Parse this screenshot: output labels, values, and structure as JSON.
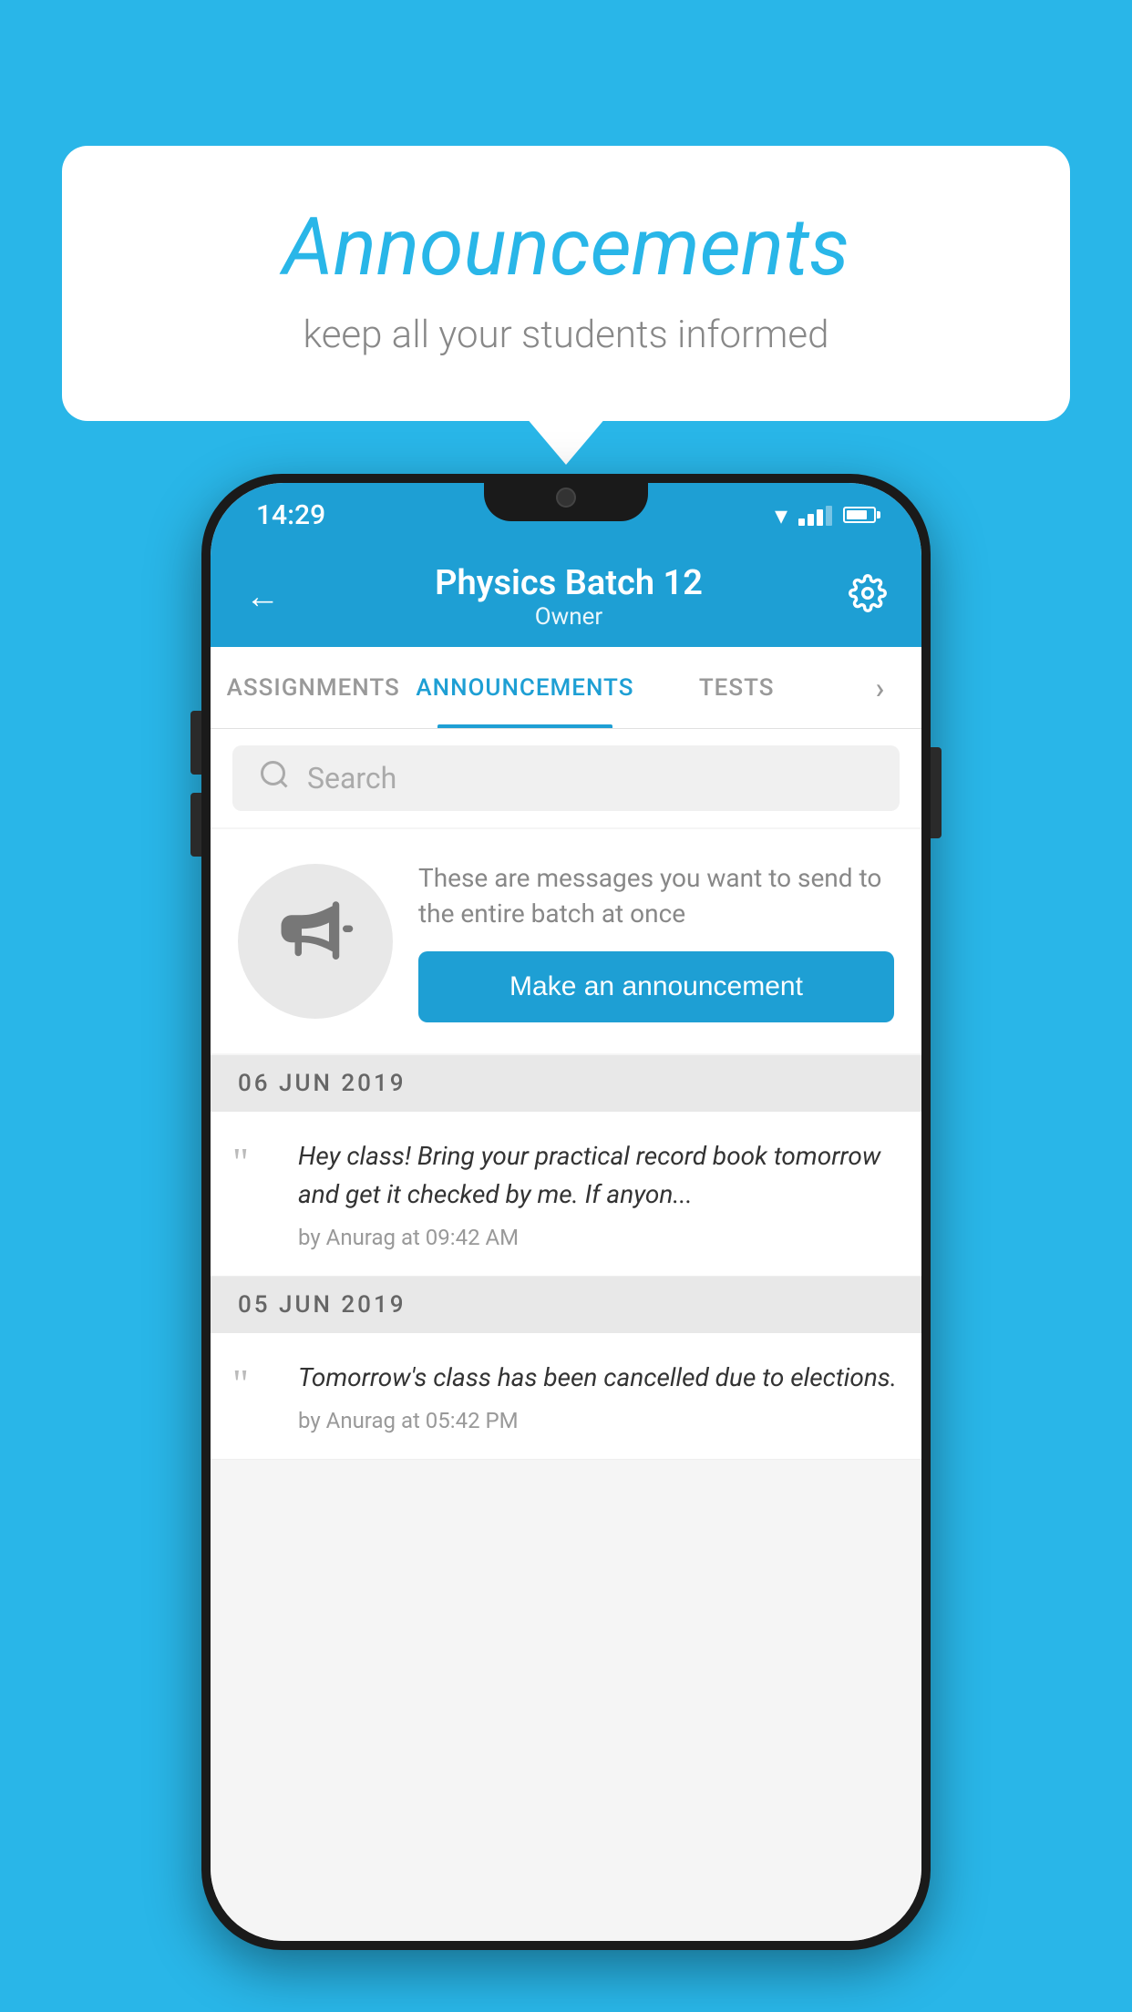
{
  "background_color": "#29b6e8",
  "bubble": {
    "title": "Announcements",
    "subtitle": "keep all your students informed"
  },
  "phone": {
    "status_bar": {
      "time": "14:29"
    },
    "app_bar": {
      "title": "Physics Batch 12",
      "subtitle": "Owner",
      "back_label": "←",
      "settings_label": "⚙"
    },
    "tabs": [
      {
        "label": "ASSIGNMENTS",
        "active": false
      },
      {
        "label": "ANNOUNCEMENTS",
        "active": true
      },
      {
        "label": "TESTS",
        "active": false
      },
      {
        "label": "›",
        "active": false
      }
    ],
    "search": {
      "placeholder": "Search"
    },
    "cta": {
      "description": "These are messages you want to send to the entire batch at once",
      "button_label": "Make an announcement"
    },
    "announcements": [
      {
        "date": "06  JUN  2019",
        "text": "Hey class! Bring your practical record book tomorrow and get it checked by me. If anyon...",
        "meta": "by Anurag at 09:42 AM"
      },
      {
        "date": "05  JUN  2019",
        "text": "Tomorrow's class has been cancelled due to elections.",
        "meta": "by Anurag at 05:42 PM"
      }
    ]
  }
}
